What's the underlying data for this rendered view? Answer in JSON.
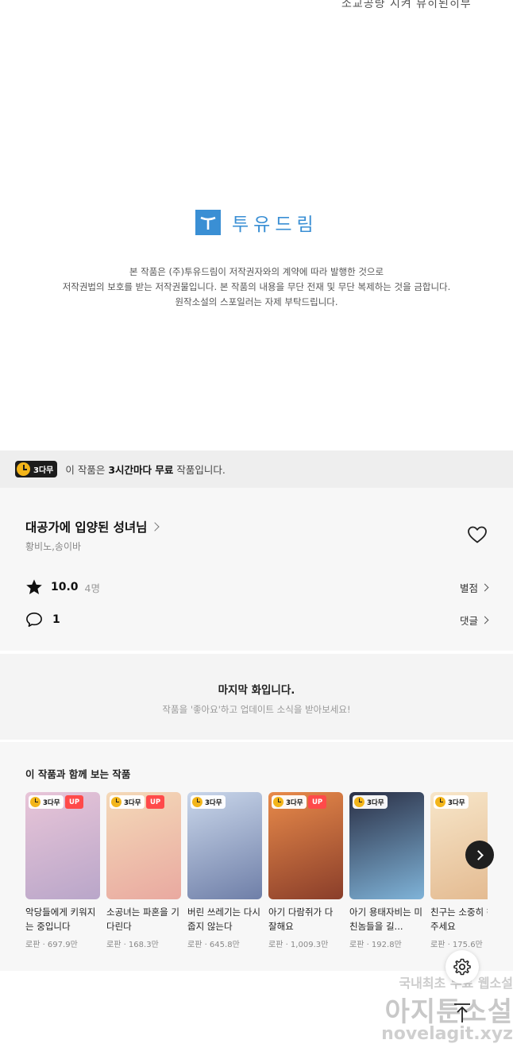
{
  "top_fragment": "소교공량 시켜 뮤히된히부",
  "publisher": {
    "logo_text": "투유드림",
    "notice_lines": [
      "본 작품은 (주)투유드림이 저작권자와의 계약에 따라 발행한 것으로",
      "저작권법의 보호를 받는 저작권물입니다. 본 작품의 내용을 무단 전재 및 무단 복제하는 것을 금합니다.",
      "원작소설의 스포일러는 자제 부탁드립니다."
    ]
  },
  "free_bar": {
    "badge": "3다무",
    "text_prefix": "이 작품은 ",
    "text_bold": "3시간마다 무료",
    "text_suffix": " 작품입니다."
  },
  "work": {
    "title": "대공가에 입양된 성녀님",
    "authors": "황비노,송이바",
    "rating": "10.0",
    "rating_count": "4명",
    "rating_link": "별점",
    "comment_count": "1",
    "comment_link": "댓글"
  },
  "last_episode": {
    "title": "마지막 화입니다.",
    "subtitle": "작품을 '좋아요'하고 업데이트 소식을 받아보세요!"
  },
  "related": {
    "title": "이 작품과 함께 보는 작품",
    "items": [
      {
        "badge": "3다무",
        "up": "UP",
        "name": "악당들에게 키워지는 중입니다",
        "meta": "로판 · 697.9만",
        "colors": [
          "#e8c5d8",
          "#b9a6c9"
        ]
      },
      {
        "badge": "3다무",
        "up": "UP",
        "name": "소공녀는 파혼을 기다린다",
        "meta": "로판 · 168.3만",
        "colors": [
          "#f4d9b8",
          "#e9a9a0"
        ]
      },
      {
        "badge": "3다무",
        "up": "",
        "name": "버린 쓰레기는 다시 줍지 않는다",
        "meta": "로판 · 645.8만",
        "colors": [
          "#c9d6ea",
          "#6f7fa8"
        ]
      },
      {
        "badge": "3다무",
        "up": "UP",
        "name": "아기 다람쥐가 다 잘해요",
        "meta": "로판 · 1,009.3만",
        "colors": [
          "#e88a4a",
          "#8a3e2a"
        ]
      },
      {
        "badge": "3다무",
        "up": "",
        "name": "아기 용태자비는 미친놈들을 길...",
        "meta": "로판 · 192.8만",
        "colors": [
          "#2a2f45",
          "#7fb3d8"
        ]
      },
      {
        "badge": "3다무",
        "up": "",
        "name": "친구는 소중히 해 주세요",
        "meta": "로판 · 175.6만",
        "colors": [
          "#f7e6c9",
          "#e3b98f"
        ]
      }
    ]
  },
  "watermark": {
    "line1": "국내최초 무료 웹소설",
    "line2": "아지툰소설",
    "line3": "novelagit.xyz"
  }
}
